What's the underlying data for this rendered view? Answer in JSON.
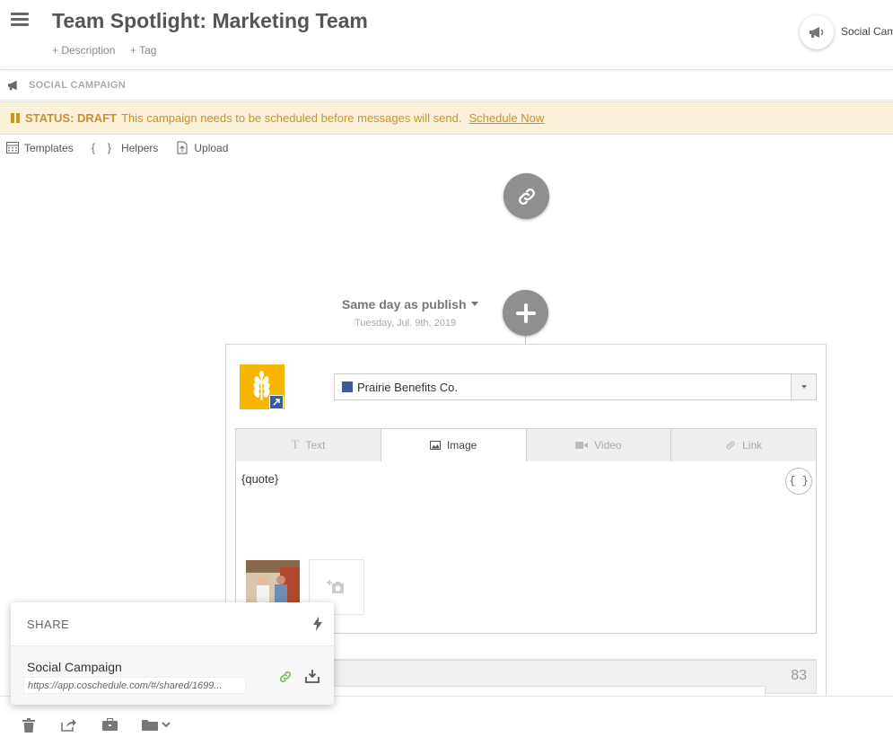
{
  "header": {
    "title": "Team Spotlight: Marketing Team",
    "description_link": "+ Description",
    "tag_link": "+ Tag",
    "type_label": "Social Campaign"
  },
  "section": {
    "label": "SOCIAL CAMPAIGN"
  },
  "status": {
    "strong": "STATUS: DRAFT",
    "message": "This campaign needs to be scheduled before messages will send.",
    "action": "Schedule Now",
    "color": "#c7932b",
    "background": "#fbf1d9"
  },
  "toolbar": {
    "templates": "Templates",
    "helpers": "Helpers",
    "upload": "Upload"
  },
  "timing": {
    "label": "Same day as publish",
    "date": "Tuesday, Jul. 9th, 2019"
  },
  "message": {
    "account": "Prairie Benefits Co.",
    "tabs": [
      {
        "label": "Text",
        "icon": "text-icon",
        "active": false
      },
      {
        "label": "Image",
        "icon": "image-icon",
        "active": true
      },
      {
        "label": "Video",
        "icon": "video-icon",
        "active": false
      },
      {
        "label": "Link",
        "icon": "link-icon",
        "active": false
      }
    ],
    "body": "{quote}",
    "helper_button": "{ }",
    "char_count": "83"
  },
  "share": {
    "title": "SHARE",
    "item_name": "Social Campaign",
    "url": "https://app.coschedule.com/#/shared/1699..."
  },
  "colors": {
    "accent_gray": "#8f8f8f",
    "brand_yellow": "#f7b500",
    "brand_blue": "#3b5aa0",
    "link_green": "#7dbb6a"
  }
}
